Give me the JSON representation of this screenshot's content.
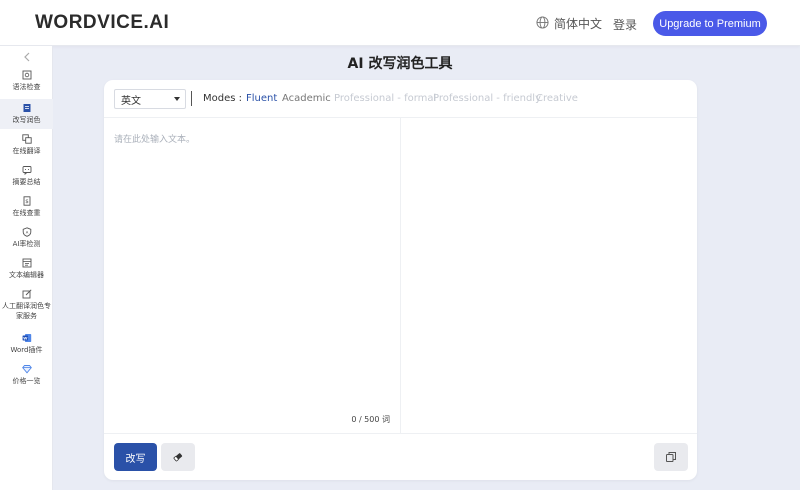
{
  "header": {
    "logo": "WORDVICE.AI",
    "language": "简体中文",
    "login": "登录",
    "premium_button": "Upgrade to Premium"
  },
  "sidebar": {
    "items": [
      {
        "label": "语法检查",
        "icon": "grammar-check-icon"
      },
      {
        "label": "改写润色",
        "icon": "paraphrase-icon",
        "active": true
      },
      {
        "label": "在线翻译",
        "icon": "translate-icon"
      },
      {
        "label": "摘要总结",
        "icon": "summary-icon"
      },
      {
        "label": "在线查重",
        "icon": "plagiarism-icon"
      },
      {
        "label": "AI率检测",
        "icon": "ai-detector-icon"
      },
      {
        "label": "文本编辑器",
        "icon": "editor-icon"
      },
      {
        "label": "人工翻译润色专家服务",
        "icon": "expert-service-icon"
      },
      {
        "label": "Word插件",
        "icon": "word-icon"
      },
      {
        "label": "价格一览",
        "icon": "pricing-icon"
      }
    ]
  },
  "page": {
    "title": "AI 改写润色工具"
  },
  "editor": {
    "language_select": "英文",
    "modes_label": "Modes :",
    "modes": [
      {
        "label": "Fluent",
        "state": "active"
      },
      {
        "label": "Academic",
        "state": "enabled"
      },
      {
        "label": "Professional - formal",
        "state": "disabled"
      },
      {
        "label": "Professional - friendly",
        "state": "disabled"
      },
      {
        "label": "Creative",
        "state": "disabled"
      }
    ],
    "placeholder": "请在此处输入文本。",
    "word_count": "0 / 500 词",
    "rewrite_button": "改写"
  },
  "colors": {
    "accent": "#4a59e8",
    "primary_button": "#2a51a8",
    "active_mode": "#2a51a8",
    "disabled_mode": "#c6cad2"
  }
}
